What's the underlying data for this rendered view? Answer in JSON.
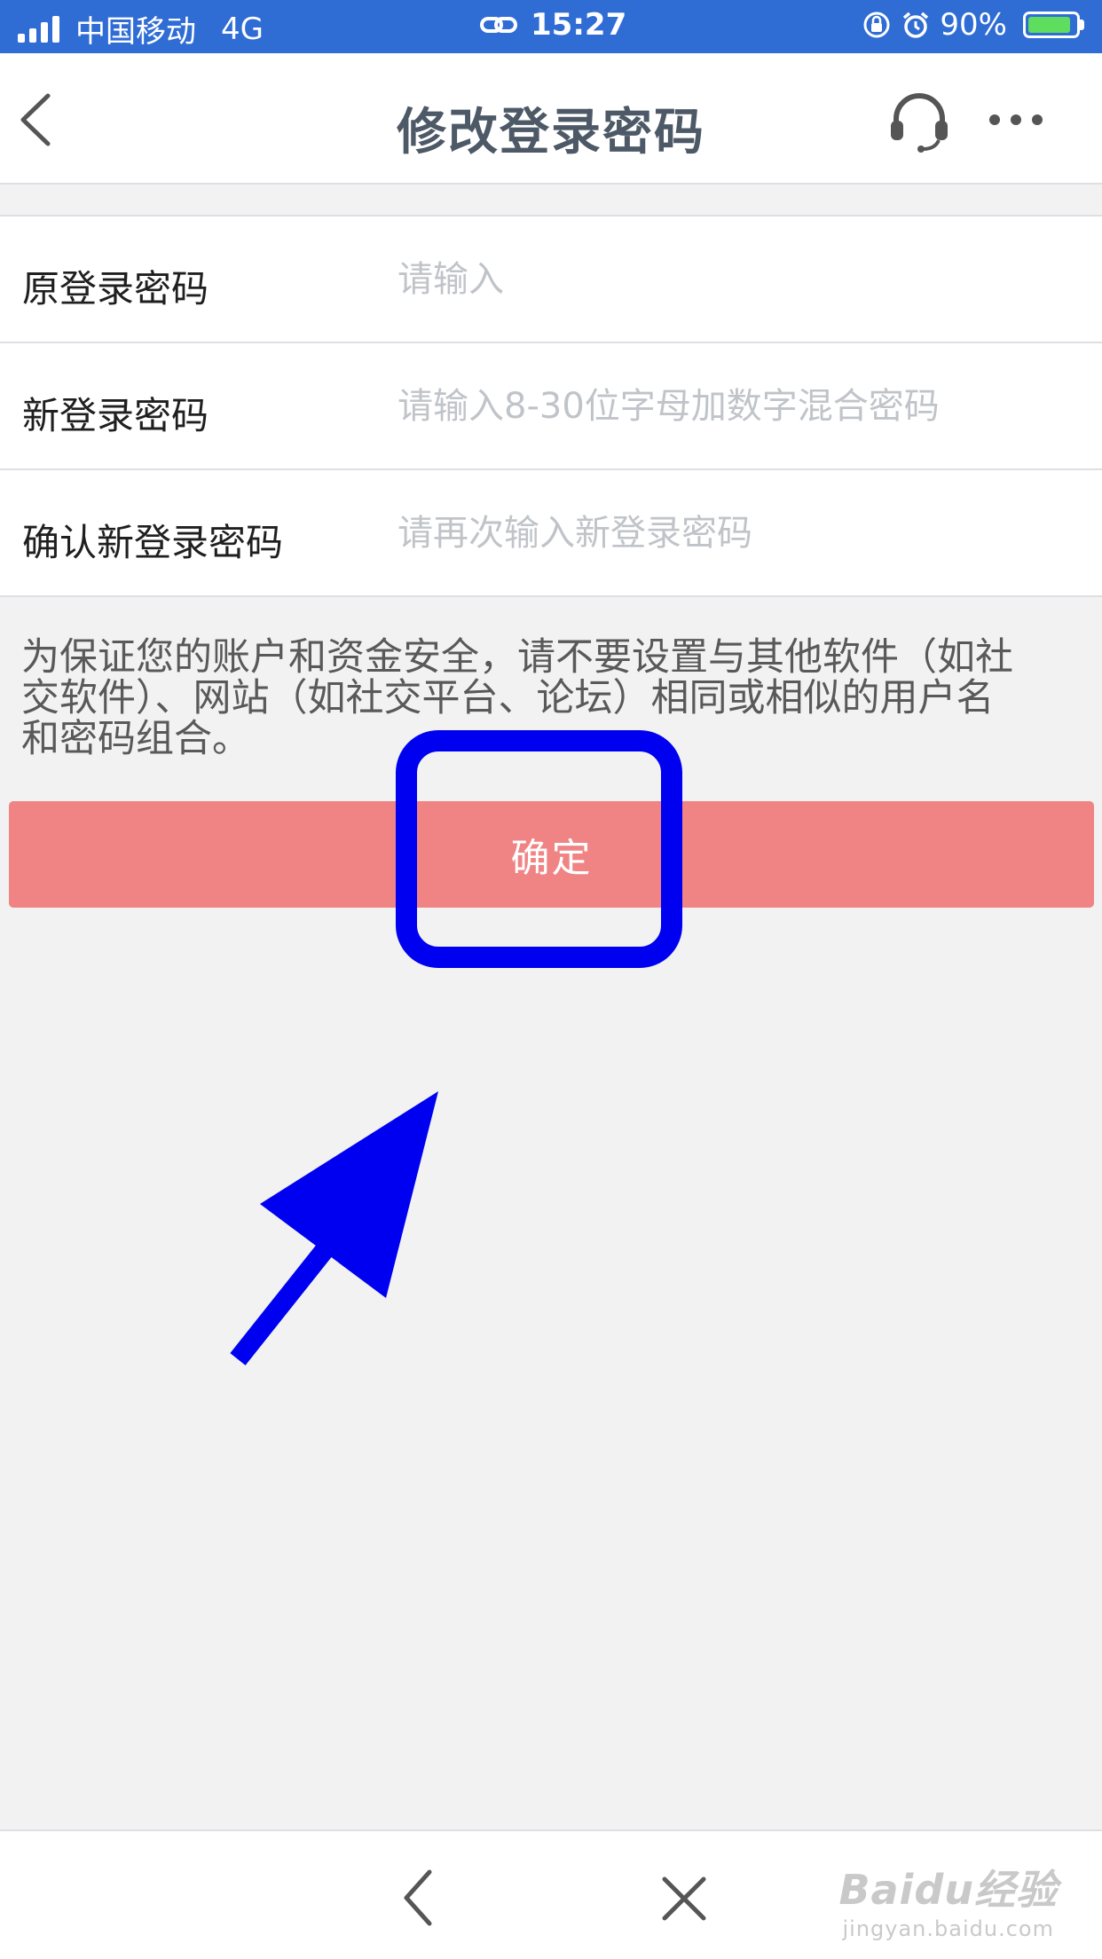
{
  "status_bar": {
    "carrier": "中国移动",
    "network": "4G",
    "time": "15:27",
    "battery_percent": "90%",
    "battery_level": 0.9,
    "icons": [
      "signal-icon",
      "link-icon",
      "orientation-lock-icon",
      "alarm-icon",
      "battery-charging-icon"
    ]
  },
  "nav": {
    "title": "修改登录密码",
    "icons": [
      "back-chevron-icon",
      "headset-icon",
      "more-icon"
    ]
  },
  "form": {
    "rows": [
      {
        "label": "原登录密码",
        "placeholder": "请输入"
      },
      {
        "label": "新登录密码",
        "placeholder": "请输入8-30位字母加数字混合密码"
      },
      {
        "label": "确认新登录密码",
        "placeholder": "请再次输入新登录密码"
      }
    ]
  },
  "notice": {
    "lines": [
      "为保证您的账户和资金安全，请不要设置与其他软件（如社",
      "交软件）、网站（如社交平台、论坛）相同或相似的用户名",
      "和密码组合。"
    ]
  },
  "confirm_button": {
    "label": "确定",
    "color": "#f08484"
  },
  "annotation": {
    "color": "#0000f0"
  },
  "bottom_bar": {
    "icons": [
      "back-chevron-icon",
      "close-icon"
    ],
    "watermark": {
      "main": "Baidu经验",
      "sub": "jingyan.baidu.com"
    }
  }
}
